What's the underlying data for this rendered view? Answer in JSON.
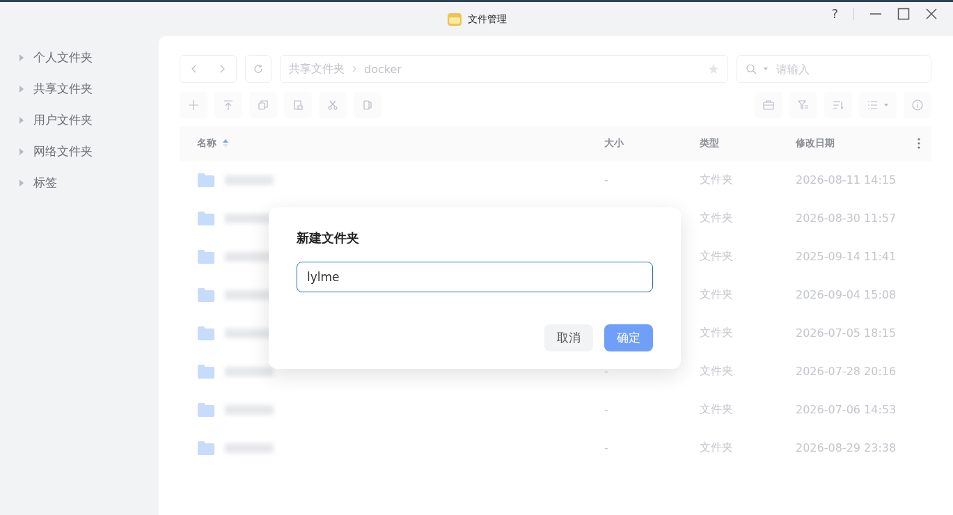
{
  "window": {
    "title": "文件管理",
    "controls": [
      "?"
    ]
  },
  "sidebar": {
    "items": [
      {
        "label": "个人文件夹"
      },
      {
        "label": "共享文件夹"
      },
      {
        "label": "用户文件夹"
      },
      {
        "label": "网络文件夹"
      },
      {
        "label": "标签"
      }
    ]
  },
  "path": {
    "segments": [
      "共享文件夹",
      "docker"
    ]
  },
  "search": {
    "placeholder": "请输入"
  },
  "table": {
    "columns": [
      {
        "label": "名称",
        "sorted": true
      },
      {
        "label": "大小",
        "sorted": false
      },
      {
        "label": "类型",
        "sorted": false
      },
      {
        "label": "修改日期",
        "sorted": false
      }
    ],
    "rows": [
      {
        "size": "-",
        "type": "文件夹",
        "date": "2026-08-11 14:15"
      },
      {
        "type": "文件夹",
        "date": "2026-08-30 11:57"
      },
      {
        "type": "文件夹",
        "date": "2025-09-14 11:41"
      },
      {
        "type": "文件夹",
        "date": "2026-09-04 15:08"
      },
      {
        "type": "文件夹",
        "date": "2026-07-05 18:15"
      },
      {
        "size": "-",
        "type": "文件夹",
        "date": "2026-07-28 20:16"
      },
      {
        "size": "-",
        "type": "文件夹",
        "date": "2026-07-06 14:53"
      },
      {
        "size": "-",
        "type": "文件夹",
        "date": "2026-08-29 23:38"
      }
    ]
  },
  "dialog": {
    "title": "新建文件夹",
    "value": "lylme",
    "buttons": [
      {
        "label": "取消",
        "kind": "secondary"
      },
      {
        "label": "确定",
        "kind": "primary"
      }
    ]
  }
}
